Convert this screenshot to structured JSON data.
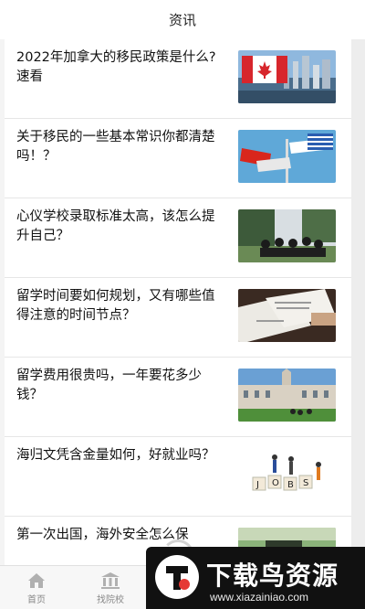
{
  "header": {
    "title": "资讯"
  },
  "articles": [
    {
      "title": "2022年加拿大的移民政策是什么?速看",
      "thumb_icon": "canada-flag-city-image"
    },
    {
      "title": "关于移民的一些基本常识你都清楚吗！？",
      "thumb_icon": "china-greece-signpost-image"
    },
    {
      "title": "心仪学校录取标准太高，该怎么提升自己？",
      "thumb_icon": "graduation-crowd-image"
    },
    {
      "title": "留学时间要如何规划，又有哪些值得注意的时间节点？",
      "thumb_icon": "documents-papers-image"
    },
    {
      "title": "留学费用很贵吗，一年要花多少钱？",
      "thumb_icon": "university-campus-image"
    },
    {
      "title": "海归文凭含金量如何，好就业吗？",
      "thumb_icon": "jobs-blocks-image"
    },
    {
      "title": "第一次出国，海外安全怎么保",
      "thumb_icon": "travel-person-image"
    }
  ],
  "tabbar": {
    "tabs": [
      {
        "label": "首页",
        "icon": "home-icon"
      },
      {
        "label": "找院校",
        "icon": "university-icon"
      }
    ]
  },
  "watermark": {
    "name": "下载鸟资源",
    "url": "www.xiazainiao.com"
  }
}
